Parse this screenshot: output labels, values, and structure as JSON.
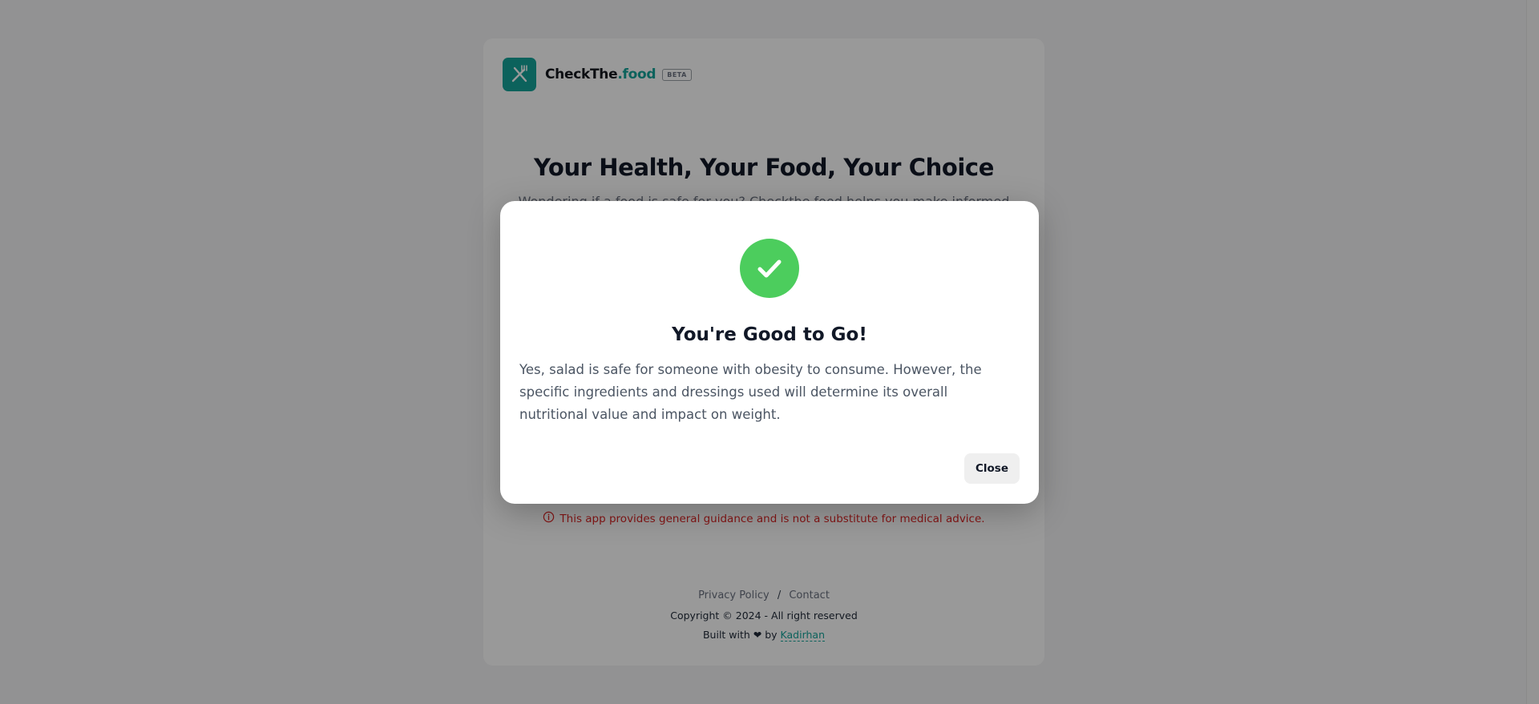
{
  "brand": {
    "name_main": "CheckThe",
    "name_accent": ".food",
    "badge": "BETA",
    "accent_color": "#14a39a"
  },
  "hero": {
    "title": "Your Health, Your Food, Your Choice",
    "subtitle": "Wondering if a food is safe for you? Checkthe.food helps you make informed"
  },
  "disclaimer": {
    "icon": "info-circle-icon",
    "text": "This app provides general guidance and is not a substitute for medical advice."
  },
  "footer": {
    "privacy": "Privacy Policy",
    "separator": "/",
    "contact": "Contact",
    "copyright": "Copyright © 2024 - All right reserved",
    "built_prefix": "Built with ❤ by",
    "author": "Kadirhan"
  },
  "modal": {
    "icon": "checkmark-icon",
    "status_color": "#4ccd5d",
    "title": "You're Good to Go!",
    "body": "Yes, salad is safe for someone with obesity to consume. However, the specific ingredients and dressings used will determine its overall nutritional value and impact on weight.",
    "close_label": "Close"
  }
}
